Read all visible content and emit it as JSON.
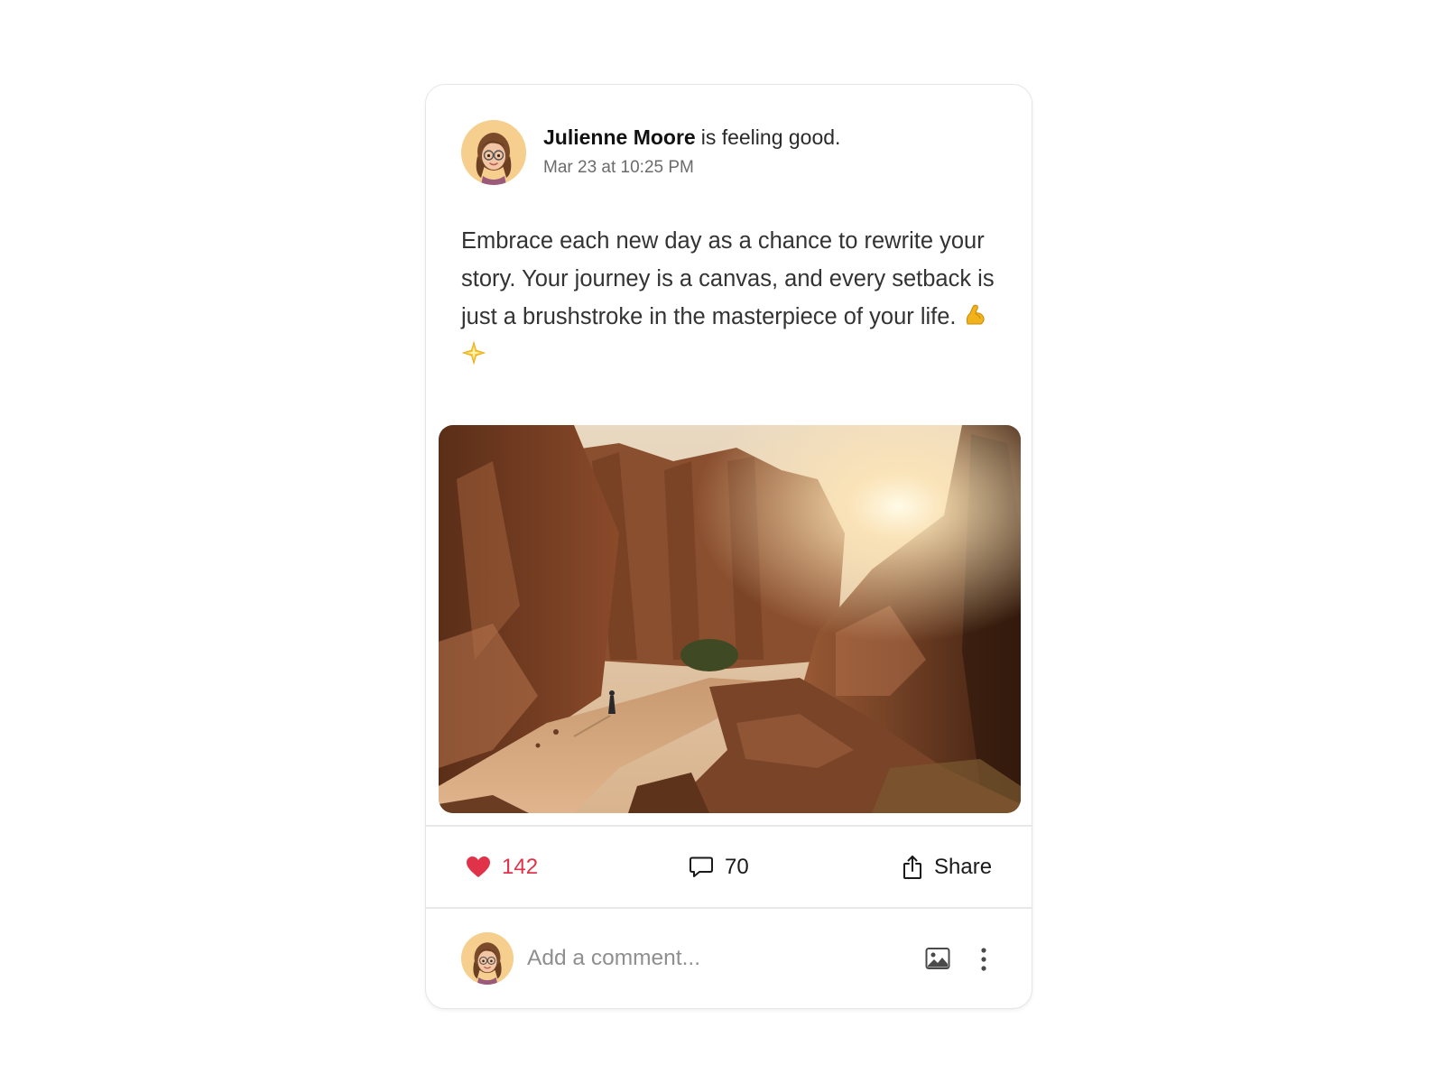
{
  "post": {
    "author": "Julienne Moore",
    "feeling": "is feeling good.",
    "timestamp": "Mar 23 at 10:25 PM",
    "body": "Embrace each new day as a chance to rewrite your story. Your journey is a canvas, and every setback is just a brushstroke in the masterpiece of your life.",
    "body_emojis": [
      "flexed-biceps-icon",
      "sparkle-star-icon"
    ],
    "image_icon": "canyon-photo"
  },
  "actions": {
    "likes": "142",
    "like_icon": "heart-icon",
    "like_color": "#e0334a",
    "comments": "70",
    "comment_icon": "speech-bubble-icon",
    "share_label": "Share",
    "share_icon": "share-icon"
  },
  "comment_box": {
    "placeholder": "Add a comment...",
    "image_icon": "image-icon",
    "more_icon": "vertical-ellipsis-icon"
  },
  "colors": {
    "accent_like": "#e0334a",
    "avatar_bg": "#f6cf8e",
    "border": "#e6e6e6"
  }
}
